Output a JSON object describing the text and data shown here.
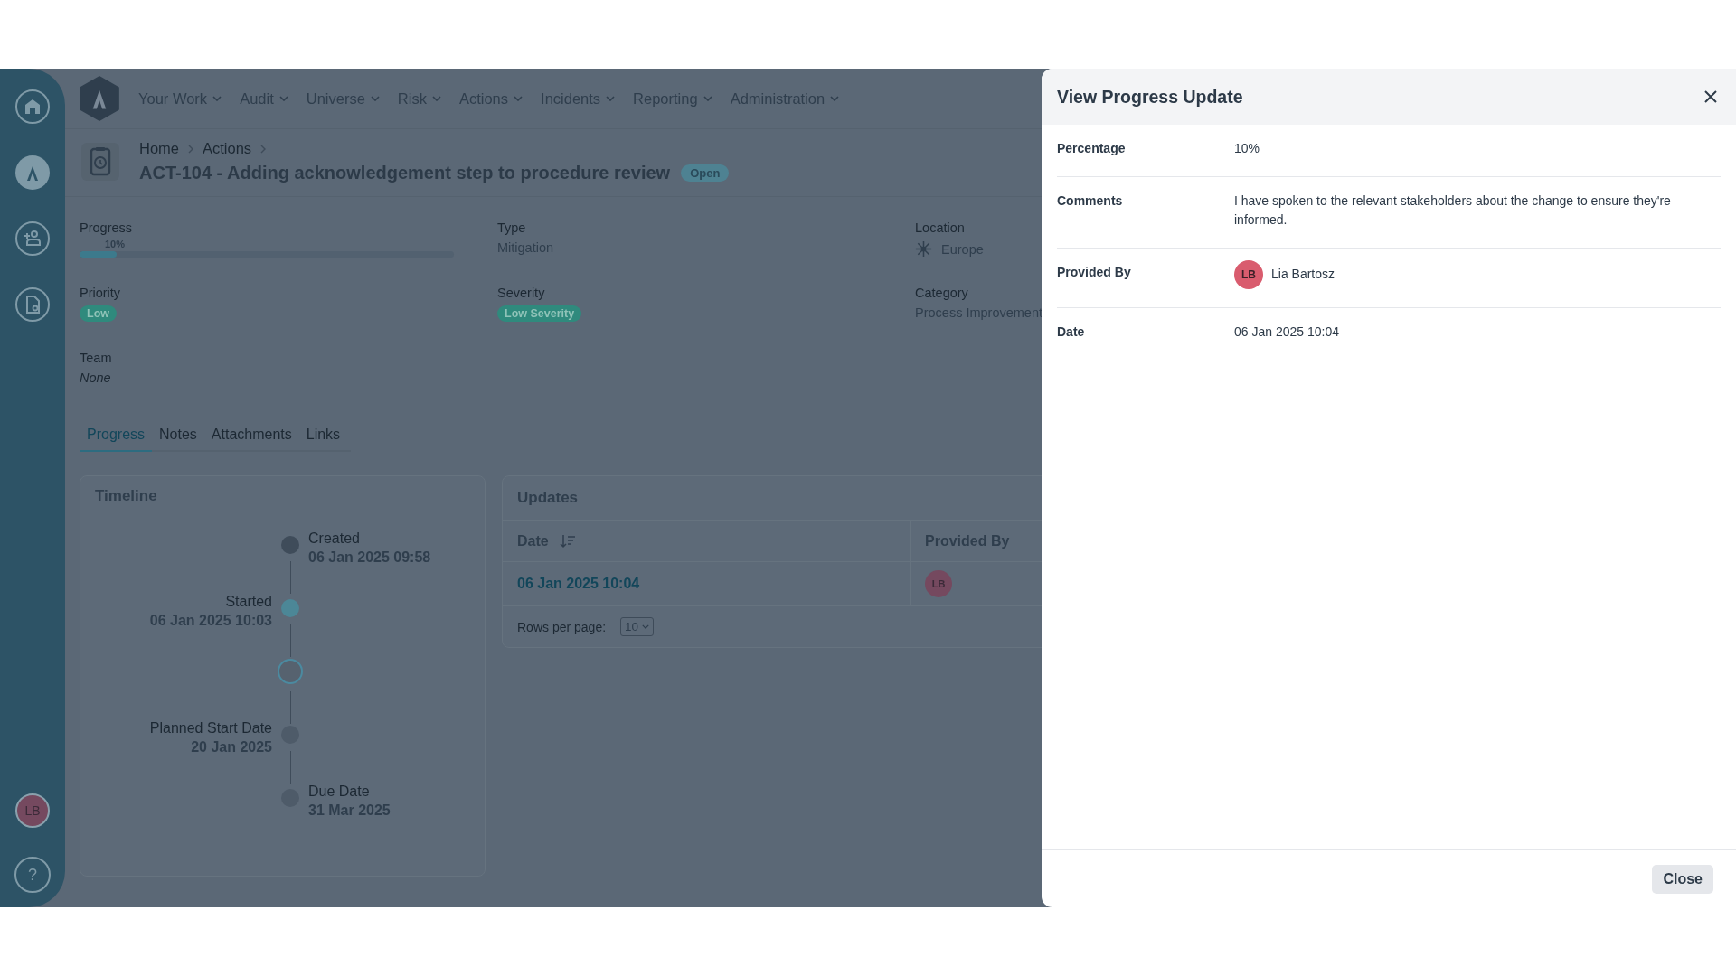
{
  "sidebar": {
    "avatar": "LB",
    "help": "?"
  },
  "nav": {
    "menu": [
      {
        "label": "Your Work"
      },
      {
        "label": "Audit"
      },
      {
        "label": "Universe"
      },
      {
        "label": "Risk"
      },
      {
        "label": "Actions"
      },
      {
        "label": "Incidents"
      },
      {
        "label": "Reporting"
      },
      {
        "label": "Administration"
      }
    ]
  },
  "breadcrumb": [
    "Home",
    "Actions"
  ],
  "title": "ACT-104 - Adding acknowledgement step to procedure review",
  "status": "Open",
  "fields": [
    {
      "kind": "progress",
      "label": "Progress",
      "reading": "10%",
      "level": 0.1
    },
    {
      "kind": "text",
      "label": "Type",
      "value": "Mitigation"
    },
    {
      "kind": "location",
      "label": "Location",
      "value": "Europe"
    },
    {
      "kind": "badge",
      "label": "Priority",
      "value": "Low"
    },
    {
      "kind": "badge",
      "label": "Severity",
      "value": "Low Severity"
    },
    {
      "kind": "text",
      "label": "Category",
      "value": "Process Improvement"
    },
    {
      "kind": "empty",
      "label": "Team",
      "value": "None"
    }
  ],
  "tabs": [
    {
      "label": "Progress",
      "selected": true
    },
    {
      "label": "Notes",
      "selected": false
    },
    {
      "label": "Attachments",
      "selected": false
    },
    {
      "label": "Links",
      "selected": false
    }
  ],
  "timeline": {
    "title": "Timeline",
    "events": [
      {
        "kind": "done",
        "right": {
          "label": "Created",
          "date": "06 Jan 2025 09:58"
        }
      },
      {
        "kind": "active",
        "left": {
          "label": "Started",
          "date": "06 Jan 2025 10:03"
        }
      },
      {
        "kind": "current"
      },
      {
        "kind": "pending",
        "left": {
          "label": "Planned Start Date",
          "date": "20 Jan 2025"
        }
      },
      {
        "kind": "pending",
        "right": {
          "label": "Due Date",
          "date": "31 Mar 2025"
        }
      }
    ]
  },
  "updates": {
    "title": "Updates",
    "columns": [
      "Date",
      "Provided By"
    ],
    "rows": [
      {
        "date": "06 Jan 2025 10:04",
        "avatar": "LB"
      }
    ],
    "rows_per_page_label": "Rows per page:",
    "rows_per_page": "10"
  },
  "drawer": {
    "title": "View Progress Update",
    "rows": [
      {
        "kind": "text",
        "label": "Percentage",
        "value": "10%"
      },
      {
        "kind": "text",
        "label": "Comments",
        "value": "I have spoken to the relevant stakeholders about the change to ensure they're informed."
      },
      {
        "kind": "person",
        "label": "Provided By",
        "avatar": "LB",
        "value": "Lia Bartosz"
      },
      {
        "kind": "text",
        "label": "Date",
        "value": "06 Jan 2025 10:04"
      }
    ],
    "button": "Close"
  }
}
